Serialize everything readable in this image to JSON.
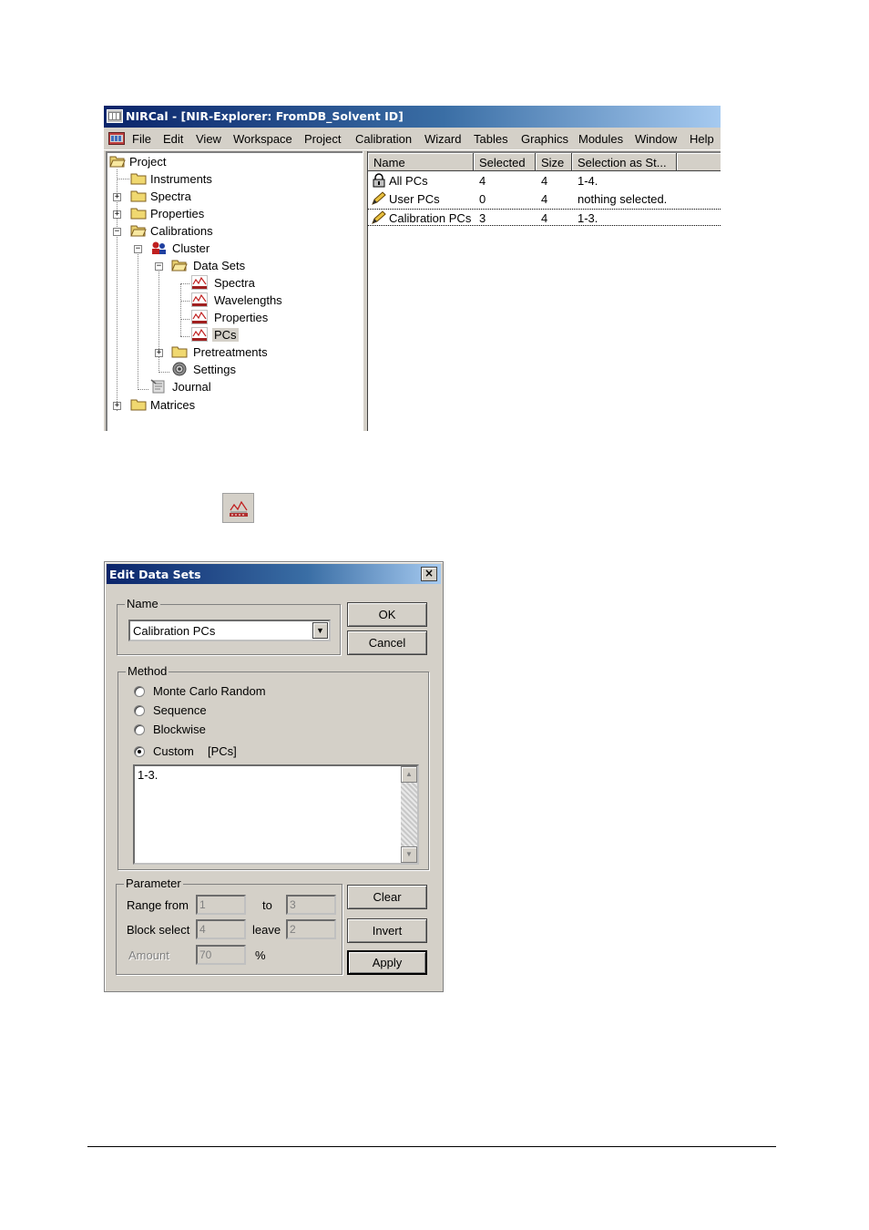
{
  "window": {
    "title": "NIRCal - [NIR-Explorer: FromDB_Solvent ID]",
    "menu": [
      "File",
      "Edit",
      "View",
      "Workspace",
      "Project",
      "Calibration",
      "Wizard",
      "Tables",
      "Graphics",
      "Modules",
      "Window",
      "Help"
    ]
  },
  "tree": {
    "project": "Project",
    "instruments": "Instruments",
    "spectra": "Spectra",
    "properties": "Properties",
    "calibrations": "Calibrations",
    "cluster": "Cluster",
    "data_sets": "Data Sets",
    "ds_spectra": "Spectra",
    "ds_wavelengths": "Wavelengths",
    "ds_properties": "Properties",
    "ds_pcs": "PCs",
    "pretreatments": "Pretreatments",
    "settings": "Settings",
    "journal": "Journal",
    "matrices": "Matrices"
  },
  "list": {
    "columns": [
      "Name",
      "Selected",
      "Size",
      "Selection as St..."
    ],
    "rows": [
      {
        "name": "All PCs",
        "selected": "4",
        "size": "4",
        "selection": "1-4.",
        "icon": "lock-icon"
      },
      {
        "name": "User PCs",
        "selected": "0",
        "size": "4",
        "selection": "nothing selected.",
        "icon": "pencil-icon"
      },
      {
        "name": "Calibration PCs",
        "selected": "3",
        "size": "4",
        "selection": "1-3.",
        "icon": "pencil-icon"
      }
    ]
  },
  "dialog": {
    "title": "Edit Data Sets",
    "close": "×",
    "name_group": "Name",
    "name_value": "Calibration PCs",
    "ok": "OK",
    "cancel": "Cancel",
    "method_group": "Method",
    "methods": [
      {
        "label": "Monte Carlo Random",
        "checked": false
      },
      {
        "label": "Sequence",
        "checked": false
      },
      {
        "label": "Blockwise",
        "checked": false
      },
      {
        "label": "Custom",
        "checked": true
      }
    ],
    "custom_unit": "[PCs]",
    "custom_text": "1-3.",
    "parameter_group": "Parameter",
    "range_from_label": "Range from",
    "range_from": "1",
    "to_label": "to",
    "range_to": "3",
    "block_select_label": "Block select",
    "block_select": "4",
    "leave_label": "leave",
    "leave": "2",
    "amount_label": "Amount",
    "amount": "70",
    "percent": "%",
    "clear": "Clear",
    "invert": "Invert",
    "apply": "Apply"
  }
}
